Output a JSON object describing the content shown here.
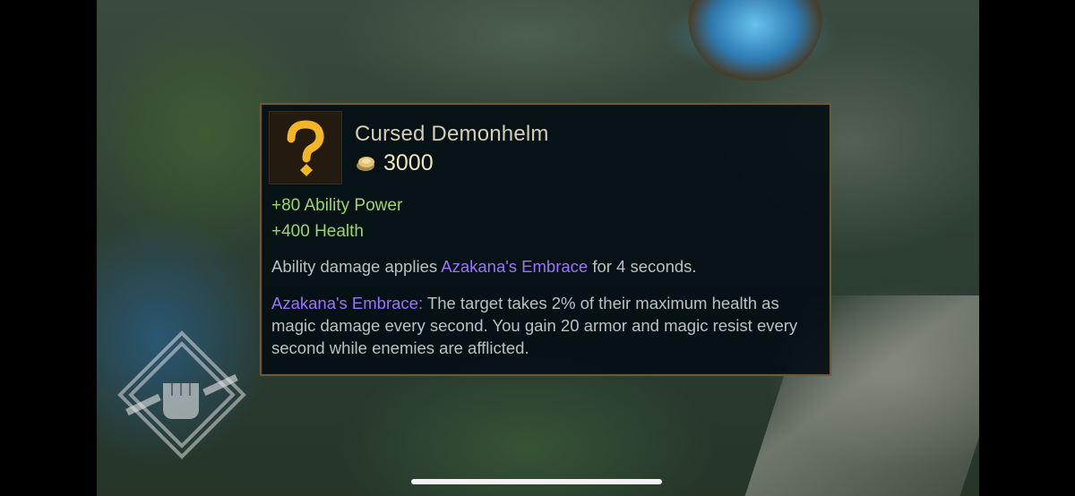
{
  "tooltip": {
    "item_name": "Cursed Demonhelm",
    "icon": "question-mark-icon",
    "cost_icon": "gold-coin-icon",
    "cost": "3000",
    "stats": [
      "+80 Ability Power",
      "+400 Health"
    ],
    "passive_prefix": "Ability damage applies ",
    "passive_keyword": "Azakana's Embrace",
    "passive_suffix": " for 4 seconds.",
    "detail_keyword": "Azakana's Embrace:",
    "detail_text": " The target takes 2% of their maximum health as magic damage every second. You gain 20 armor and magic resist every second while enemies are afflicted."
  },
  "colors": {
    "stat_green": "#9ad66a",
    "keyword_purple": "#9c72ff",
    "gold": "#f0e6b8",
    "border": "#6b5a3a"
  },
  "hud": {
    "emblem_icon": "fist-wrench-emblem-icon"
  }
}
